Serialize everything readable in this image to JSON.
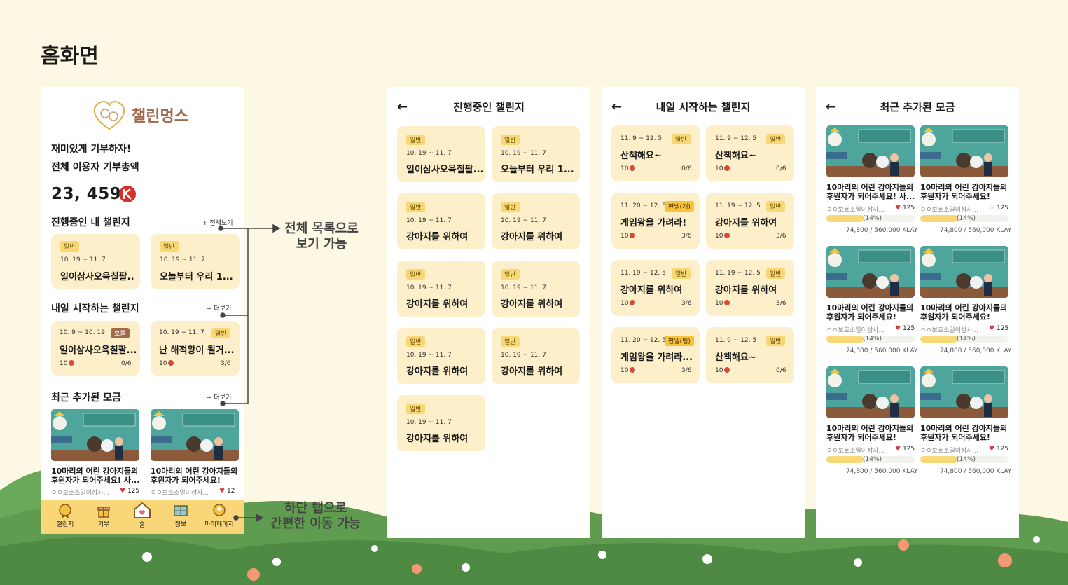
{
  "page_title": "홈화면",
  "home": {
    "logo_text": "챌린멍스",
    "tagline": "재미있게 기부하자!",
    "total_label": "전체 이용자 기부총액",
    "total_value": "23, 459",
    "ongoing": {
      "title": "진행중인 내 챌린지",
      "more": "+ 전체보기",
      "cards": [
        {
          "badge": "일반",
          "date": "10. 19 ~ 11. 7",
          "title": "일이삼사오육칠팔.."
        },
        {
          "badge": "일반",
          "date": "10. 19 ~ 11. 7",
          "title": "오늘부터 우리 1..."
        }
      ]
    },
    "tomorrow": {
      "title": "내일 시작하는 챌린지",
      "more": "+ 더보기",
      "cards": [
        {
          "date": "10. 9 ~ 10. 19",
          "badge": "보물",
          "title": "일이삼사오육칠팔...",
          "count": "10",
          "progress": "0/6"
        },
        {
          "date": "10. 19 ~ 11. 7",
          "badge": "일반",
          "title": "난 해적왕이 될거...",
          "count": "10",
          "progress": "3/6"
        }
      ]
    },
    "recent": {
      "title": "최근 추가된 모금",
      "more": "+ 더보기",
      "items": [
        {
          "title_line1": "10마리의 어린 강아지들의",
          "title_line2": "후원자가 되어주세요! 사...",
          "org": "ㅇㅇ보호소일이삼사...",
          "likes": "125"
        },
        {
          "title_line1": "10마리의 어린 강아지들의",
          "title_line2": "후원자가 되어주세요!",
          "org": "ㅇㅇ보호소일이삼사...",
          "likes": "12"
        }
      ]
    },
    "tabs": [
      {
        "label": "챌린지",
        "icon": "medal-icon"
      },
      {
        "label": "기부",
        "icon": "gift-icon"
      },
      {
        "label": "홈",
        "icon": "home-icon"
      },
      {
        "label": "정보",
        "icon": "map-icon"
      },
      {
        "label": "마이페이지",
        "icon": "profile-icon"
      }
    ]
  },
  "ongoing_screen": {
    "back": "←",
    "title": "진행중인 챌린지",
    "cards": [
      {
        "badge": "일반",
        "date": "10. 19 ~ 11. 7",
        "title": "일이삼사오육칠팔..."
      },
      {
        "badge": "일반",
        "date": "10. 19 ~ 11. 7",
        "title": "오늘부터 우리 1..."
      },
      {
        "badge": "일반",
        "date": "10. 19 ~ 11. 7",
        "title": "강아지를 위하여"
      },
      {
        "badge": "일반",
        "date": "10. 19 ~ 11. 7",
        "title": "강아지를 위하여"
      },
      {
        "badge": "일반",
        "date": "10. 19 ~ 11. 7",
        "title": "강아지를 위하여"
      },
      {
        "badge": "일반",
        "date": "10. 19 ~ 11. 7",
        "title": "강아지를 위하여"
      },
      {
        "badge": "일반",
        "date": "10. 19 ~ 11. 7",
        "title": "강아지를 위하여"
      },
      {
        "badge": "일반",
        "date": "10. 19 ~ 11. 7",
        "title": "강아지를 위하여"
      },
      {
        "badge": "일반",
        "date": "10. 19 ~ 11. 7",
        "title": "강아지를 위하여"
      }
    ]
  },
  "tomorrow_screen": {
    "back": "←",
    "title": "내일 시작하는 챌린지",
    "cards": [
      {
        "date": "11. 9 ~ 12. 5",
        "badge": "일반",
        "title": "산책해요~",
        "count": "10",
        "progress": "0/6"
      },
      {
        "date": "11. 9 ~ 12. 5",
        "badge": "일반",
        "title": "산책해요~",
        "count": "10",
        "progress": "0/6"
      },
      {
        "date": "11. 20 ~ 12. 5",
        "badge": "판넬(개)",
        "title": "게임왕을 가려라!",
        "count": "10",
        "progress": "3/6"
      },
      {
        "date": "11. 19 ~ 12. 5",
        "badge": "일반",
        "title": "강아지를 위하여",
        "count": "10",
        "progress": "3/6"
      },
      {
        "date": "11. 19 ~ 12. 5",
        "badge": "일반",
        "title": "강아지를 위하여",
        "count": "10",
        "progress": "3/6"
      },
      {
        "date": "11. 19 ~ 12. 5",
        "badge": "일반",
        "title": "강아지를 위하여",
        "count": "10",
        "progress": "3/6"
      },
      {
        "date": "11. 20 ~ 12. 5",
        "badge": "판넬(팀)",
        "title": "게임왕을 가려라...",
        "count": "10",
        "progress": "3/6"
      },
      {
        "date": "11. 9 ~ 12. 5",
        "badge": "일반",
        "title": "산책해요~",
        "count": "10",
        "progress": "0/6"
      }
    ]
  },
  "recent_screen": {
    "back": "←",
    "title": "최근 추가된 모금",
    "items": [
      {
        "title_line1": "10마리의 어린 강아지들의",
        "title_line2": "후원자가 되어주세요! 사...",
        "org": "ㅇㅇ보호소일이삼사...",
        "likes": "125",
        "liked": true,
        "percent": "(14%)",
        "fill": 0.14,
        "amount": "74,800 / 560,000 KLAY"
      },
      {
        "title_line1": "10마리의 어린 강아지들의",
        "title_line2": "후원자가 되어주세요!",
        "org": "ㅇㅇ보호소일이삼사...",
        "likes": "125",
        "liked": false,
        "percent": "(14%)",
        "fill": 0.14,
        "amount": "74,800 / 560,000 KLAY"
      },
      {
        "title_line1": "10마리의 어린 강아지들의",
        "title_line2": "후원자가 되어주세요!",
        "org": "ㅇㅇ보호소일이삼사...",
        "likes": "125",
        "liked": true,
        "percent": "(14%)",
        "fill": 0.14,
        "amount": "74,800 / 560,000 KLAY"
      },
      {
        "title_line1": "10마리의 어린 강아지들의",
        "title_line2": "후원자가 되어주세요!",
        "org": "ㅇㅇ보호소일이삼사...",
        "likes": "125",
        "liked": true,
        "percent": "(14%)",
        "fill": 0.14,
        "amount": "74,800 / 560,000 KLAY"
      },
      {
        "title_line1": "10마리의 어린 강아지들의",
        "title_line2": "후원자가 되어주세요!",
        "org": "ㅇㅇ보호소일이삼사...",
        "likes": "125",
        "liked": true,
        "percent": "(14%)",
        "fill": 0.14,
        "amount": "74,800 / 560,000 KLAY"
      },
      {
        "title_line1": "10마리의 어린 강아지들의",
        "title_line2": "후원자가 되어주세요!",
        "org": "ㅇㅇ보호소일이삼사...",
        "likes": "125",
        "liked": true,
        "percent": "(14%)",
        "fill": 0.14,
        "amount": "74,800 / 560,000 KLAY"
      }
    ]
  },
  "annotations": {
    "list_line1": "전체 목록으로",
    "list_line2": "보기 가능",
    "tab_line1": "하단 탭으로",
    "tab_line2": "간편한 이동 가능"
  },
  "colors": {
    "card_bg": "#fdefc9",
    "accent": "#f7d776",
    "tabbar": "#f9d778",
    "brand_brown": "#a0694b",
    "thumb_teal": "#4ea59c"
  }
}
